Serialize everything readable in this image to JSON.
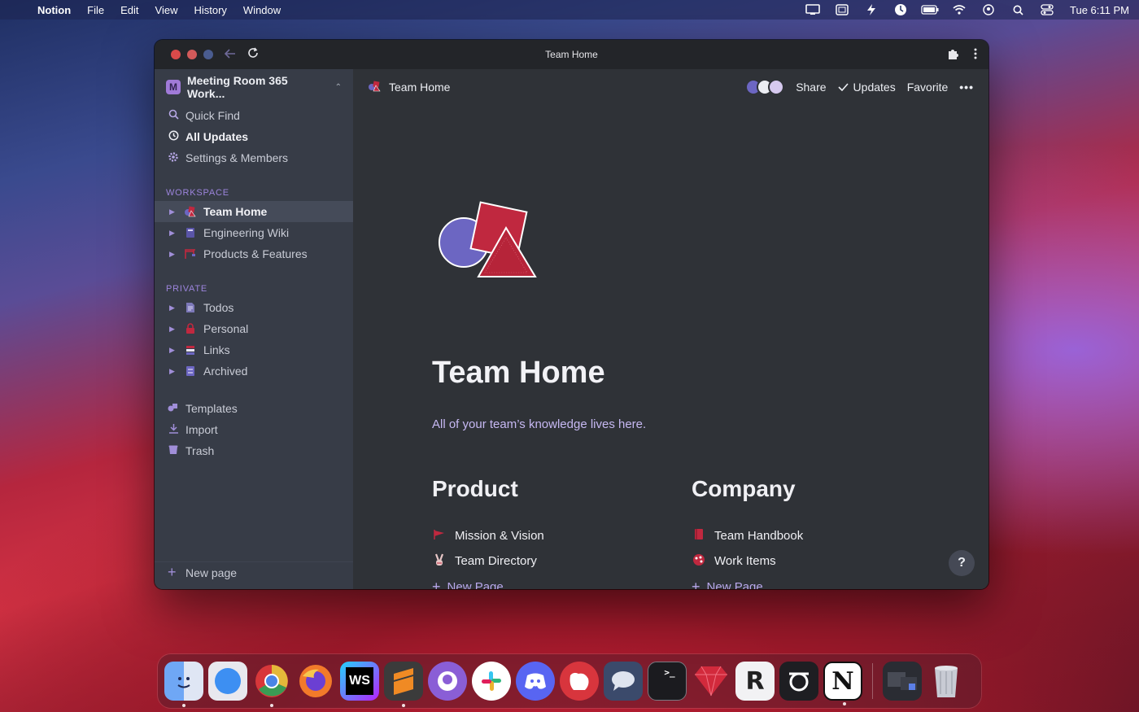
{
  "menubar": {
    "app_name": "Notion",
    "menus": [
      "File",
      "Edit",
      "View",
      "History",
      "Window"
    ],
    "clock": "Tue 6:11 PM"
  },
  "window": {
    "title": "Team Home"
  },
  "sidebar": {
    "workspace_badge": "M",
    "workspace_name": "Meeting Room 365 Work...",
    "top_items": [
      {
        "label": "Quick Find",
        "icon": "search-icon"
      },
      {
        "label": "All Updates",
        "icon": "clock-icon"
      },
      {
        "label": "Settings & Members",
        "icon": "gear-icon"
      }
    ],
    "workspace_section": "WORKSPACE",
    "workspace_pages": [
      {
        "label": "Team Home",
        "icon": "shapes-icon"
      },
      {
        "label": "Engineering Wiki",
        "icon": "book-icon"
      },
      {
        "label": "Products & Features",
        "icon": "crane-icon"
      }
    ],
    "private_section": "PRIVATE",
    "private_pages": [
      {
        "label": "Todos",
        "icon": "page-icon"
      },
      {
        "label": "Personal",
        "icon": "lock-icon"
      },
      {
        "label": "Links",
        "icon": "links-icon"
      },
      {
        "label": "Archived",
        "icon": "archive-icon"
      }
    ],
    "bottom_items": [
      {
        "label": "Templates",
        "icon": "templates-icon"
      },
      {
        "label": "Import",
        "icon": "download-icon"
      },
      {
        "label": "Trash",
        "icon": "trash-icon"
      }
    ],
    "new_page": "New page"
  },
  "topbar": {
    "breadcrumb": "Team Home",
    "share": "Share",
    "updates": "Updates",
    "favorite": "Favorite",
    "more": "•••"
  },
  "page": {
    "title": "Team Home",
    "subtitle": "All of your team’s knowledge lives here.",
    "columns": [
      {
        "heading": "Product",
        "links": [
          {
            "label": "Mission & Vision",
            "icon": "flag-icon"
          },
          {
            "label": "Team Directory",
            "icon": "peace-hand-icon"
          }
        ],
        "add_label": "New Page"
      },
      {
        "heading": "Company",
        "links": [
          {
            "label": "Team Handbook",
            "icon": "red-book-icon"
          },
          {
            "label": "Work Items",
            "icon": "paint-icon"
          }
        ],
        "add_label": "New Page"
      }
    ],
    "help": "?"
  },
  "dock": {
    "apps": [
      "finder-icon",
      "safari-icon",
      "chrome-icon",
      "firefox-icon",
      "webstorm-icon",
      "sublime-icon",
      "github-desktop-icon",
      "slack-icon",
      "discord-icon",
      "bear-icon",
      "messages-icon",
      "terminal-icon",
      "ruby-icon",
      "rapidapi-icon",
      "outline-icon",
      "notion-icon",
      "screens-icon",
      "trash-dock-icon"
    ]
  },
  "colors": {
    "accent": "#b9a8ec",
    "sidebar_bg": "#373c47",
    "main_bg": "#2f3237"
  }
}
